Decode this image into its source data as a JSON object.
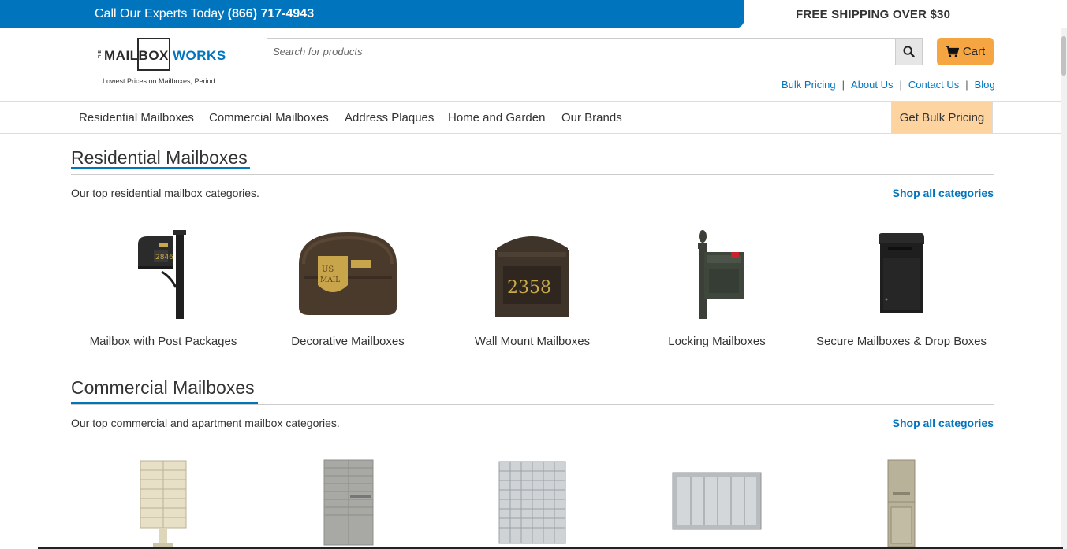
{
  "topbar": {
    "call_text": "Call Our Experts Today",
    "phone": "(866) 717-4943",
    "shipping": "FREE SHIPPING OVER $30"
  },
  "logo": {
    "the": "THE",
    "mailbox": "MAILBOX",
    "works": "WORKS",
    "tagline": "Lowest Prices on Mailboxes, Period."
  },
  "search": {
    "placeholder": "Search for products",
    "icon": "search-icon"
  },
  "cart": {
    "label": "Cart",
    "icon": "cart-icon"
  },
  "toplinks": [
    "Bulk Pricing",
    "About Us",
    "Contact Us",
    "Blog"
  ],
  "nav": {
    "items": [
      "Residential Mailboxes",
      "Commercial Mailboxes",
      "Address Plaques",
      "Home and Garden",
      "Our Brands"
    ],
    "bulk_button": "Get Bulk Pricing"
  },
  "residential": {
    "title": "Residential Mailboxes",
    "description": "Our top residential mailbox categories.",
    "shop_all": "Shop all categories",
    "products": [
      {
        "label": "Mailbox with Post Packages",
        "icon": "mailbox-post-image"
      },
      {
        "label": "Decorative Mailboxes",
        "icon": "decorative-mailbox-image"
      },
      {
        "label": "Wall Mount Mailboxes",
        "icon": "wall-mount-mailbox-image"
      },
      {
        "label": "Locking Mailboxes",
        "icon": "locking-mailbox-image"
      },
      {
        "label": "Secure Mailboxes & Drop Boxes",
        "icon": "drop-box-image"
      }
    ]
  },
  "commercial": {
    "title": "Commercial Mailboxes",
    "description": "Our top commercial and apartment mailbox categories.",
    "shop_all": "Shop all categories"
  },
  "colors": {
    "brand_blue": "#0075be",
    "cart_orange": "#f5a642",
    "bulk_peach": "#fdd3a0"
  }
}
